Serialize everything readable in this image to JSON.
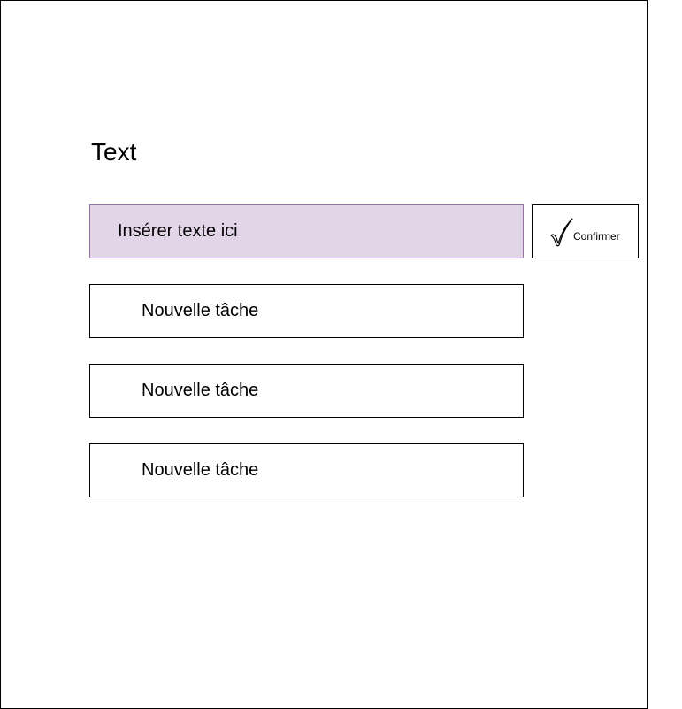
{
  "header": {
    "title": "Text"
  },
  "input": {
    "value": "Insérer texte ici",
    "background": "#e1d5e7",
    "border": "#9673a6"
  },
  "confirm": {
    "label": "Confirmer",
    "icon": "checkmark-icon"
  },
  "tasks": [
    {
      "label": "Nouvelle tâche"
    },
    {
      "label": "Nouvelle tâche"
    },
    {
      "label": "Nouvelle tâche"
    }
  ]
}
